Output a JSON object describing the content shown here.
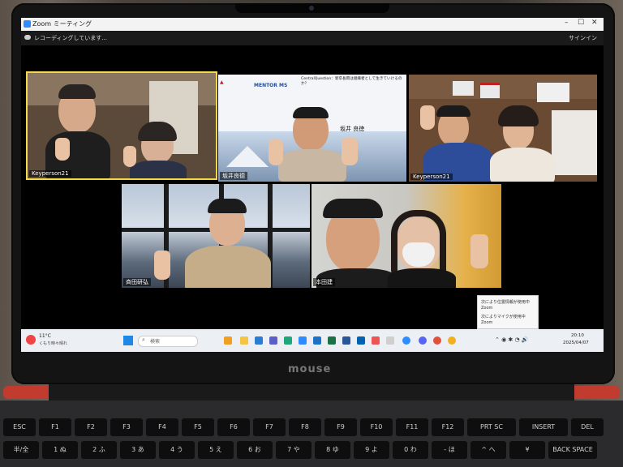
{
  "zoom": {
    "window_title": "Zoom ミーティング",
    "recording_text": "レコーディングしています...",
    "sign_in": "サインイン",
    "participants": [
      {
        "name": "Keyperson21"
      },
      {
        "name": "坂井良德"
      },
      {
        "name": "Keyperson21"
      },
      {
        "name": "斉田研弘"
      },
      {
        "name": "本田建"
      }
    ],
    "slide": {
      "heading": "CentralQuestion：新卒長岡は組織者として生きていけるのか？",
      "presenter": "坂井 良徳",
      "logo_text": "MENTOR MS"
    }
  },
  "toast": {
    "line1": "次により位置情報が使用中",
    "line2": "Zoom",
    "line3": "次によりマイクが使用中",
    "line4": "Zoom"
  },
  "taskbar": {
    "weather_temp": "11°C",
    "weather_desc": "くもり時々晴れ",
    "search_placeholder": "検索",
    "time": "20:10",
    "date": "2025/04/07"
  },
  "laptop": {
    "brand": "mouse"
  },
  "keyboard": {
    "row1": [
      "ESC",
      "F1",
      "F2",
      "F3",
      "F4",
      "F5",
      "F6",
      "F7",
      "F8",
      "F9",
      "F10",
      "F11",
      "F12",
      "PRT SC",
      "INSERT",
      "DEL"
    ],
    "row2": [
      "半/全",
      "1 ぬ",
      "2 ふ",
      "3 あ",
      "4 う",
      "5 え",
      "6 お",
      "7 や",
      "8 ゆ",
      "9 よ",
      "0 わ",
      "- ほ",
      "^ へ",
      "¥",
      "BACK SPACE"
    ]
  },
  "colors": {
    "zoom_blue": "#2d8cff",
    "active_speaker": "#f2d84b",
    "laptop_red": "#c23b2f"
  }
}
